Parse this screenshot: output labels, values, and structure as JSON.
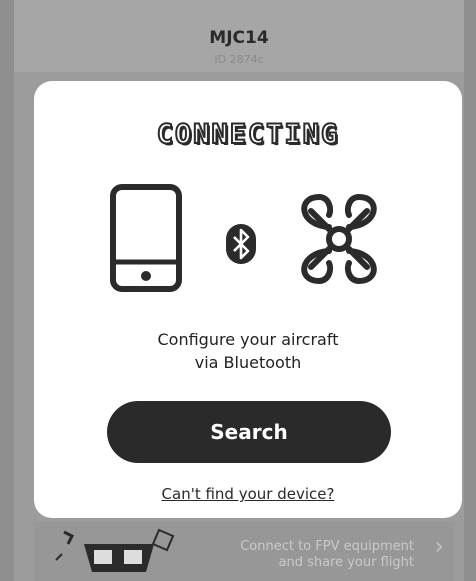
{
  "header": {
    "device_name": "MJC14",
    "device_id": "ID 2874c"
  },
  "banner": {
    "line1": "Connect to FPV equipment",
    "line2": "and share your flight"
  },
  "modal": {
    "title": "CONNECTING",
    "description_line1": "Configure your aircraft",
    "description_line2": "via Bluetooth",
    "search_label": "Search",
    "help_link": "Can't find your device?"
  },
  "icons": {
    "phone": "smartphone-icon",
    "bluetooth": "bluetooth-icon",
    "aircraft": "drone-icon",
    "banner_arrow": "chevron-right-icon"
  }
}
